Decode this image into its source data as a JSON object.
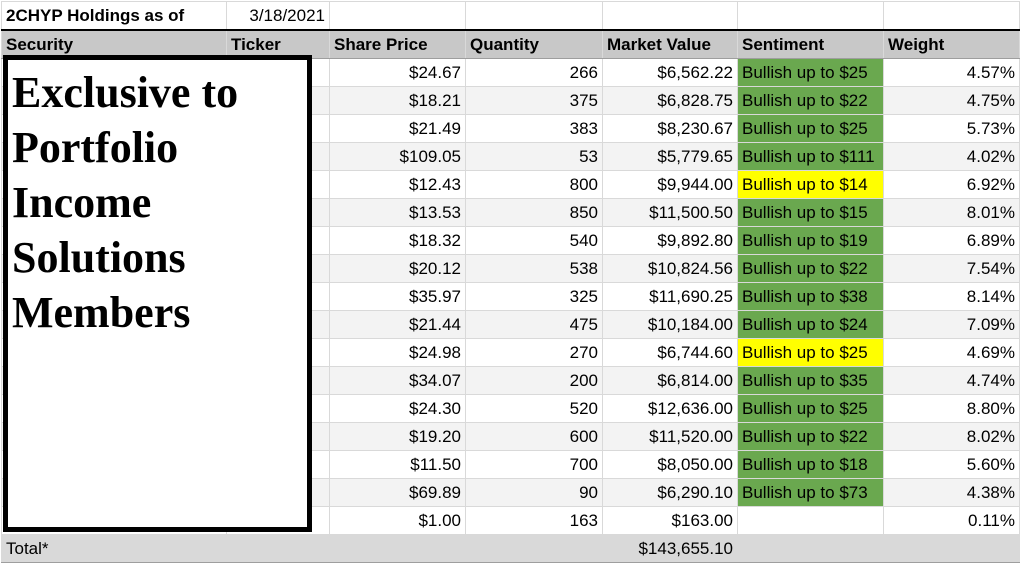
{
  "sheet": {
    "title": "2CHYP Holdings as of",
    "date": "3/18/2021",
    "headers": [
      "Security",
      "Ticker",
      "Share Price",
      "Quantity",
      "Market Value",
      "Sentiment",
      "Weight"
    ],
    "rows": [
      {
        "price": "$24.67",
        "qty": "266",
        "value": "$6,562.22",
        "sentiment": "Bullish up to $25",
        "tone": "green",
        "weight": "4.57%"
      },
      {
        "price": "$18.21",
        "qty": "375",
        "value": "$6,828.75",
        "sentiment": "Bullish up to $22",
        "tone": "green",
        "weight": "4.75%"
      },
      {
        "price": "$21.49",
        "qty": "383",
        "value": "$8,230.67",
        "sentiment": "Bullish up to $25",
        "tone": "green",
        "weight": "5.73%"
      },
      {
        "price": "$109.05",
        "qty": "53",
        "value": "$5,779.65",
        "sentiment": "Bullish up to $111",
        "tone": "green",
        "weight": "4.02%"
      },
      {
        "price": "$12.43",
        "qty": "800",
        "value": "$9,944.00",
        "sentiment": "Bullish up to $14",
        "tone": "yellow",
        "weight": "6.92%"
      },
      {
        "price": "$13.53",
        "qty": "850",
        "value": "$11,500.50",
        "sentiment": "Bullish up to $15",
        "tone": "green",
        "weight": "8.01%"
      },
      {
        "price": "$18.32",
        "qty": "540",
        "value": "$9,892.80",
        "sentiment": "Bullish up to $19",
        "tone": "green",
        "weight": "6.89%"
      },
      {
        "price": "$20.12",
        "qty": "538",
        "value": "$10,824.56",
        "sentiment": "Bullish up to $22",
        "tone": "green",
        "weight": "7.54%"
      },
      {
        "price": "$35.97",
        "qty": "325",
        "value": "$11,690.25",
        "sentiment": "Bullish up to $38",
        "tone": "green",
        "weight": "8.14%"
      },
      {
        "price": "$21.44",
        "qty": "475",
        "value": "$10,184.00",
        "sentiment": "Bullish up to $24",
        "tone": "green",
        "weight": "7.09%"
      },
      {
        "price": "$24.98",
        "qty": "270",
        "value": "$6,744.60",
        "sentiment": "Bullish up to $25",
        "tone": "yellow",
        "weight": "4.69%"
      },
      {
        "price": "$34.07",
        "qty": "200",
        "value": "$6,814.00",
        "sentiment": "Bullish up to $35",
        "tone": "green",
        "weight": "4.74%"
      },
      {
        "price": "$24.30",
        "qty": "520",
        "value": "$12,636.00",
        "sentiment": "Bullish up to $25",
        "tone": "green",
        "weight": "8.80%"
      },
      {
        "price": "$19.20",
        "qty": "600",
        "value": "$11,520.00",
        "sentiment": "Bullish up to $22",
        "tone": "green",
        "weight": "8.02%"
      },
      {
        "price": "$11.50",
        "qty": "700",
        "value": "$8,050.00",
        "sentiment": "Bullish up to $18",
        "tone": "green",
        "weight": "5.60%"
      },
      {
        "price": "$69.89",
        "qty": "90",
        "value": "$6,290.10",
        "sentiment": "Bullish up to $73",
        "tone": "green",
        "weight": "4.38%"
      },
      {
        "price": "$1.00",
        "qty": "163",
        "value": "$163.00",
        "sentiment": "",
        "tone": "none",
        "weight": "0.11%"
      }
    ],
    "total_label": "Total*",
    "total_value": "$143,655.10"
  },
  "overlay": {
    "text": "Exclusive to\nPortfolio\nIncome\nSolutions\nMembers"
  },
  "colors": {
    "bullish_green": "#6aa84f",
    "highlight_yellow": "#ffff00",
    "header_gray": "#c8c8c8"
  }
}
